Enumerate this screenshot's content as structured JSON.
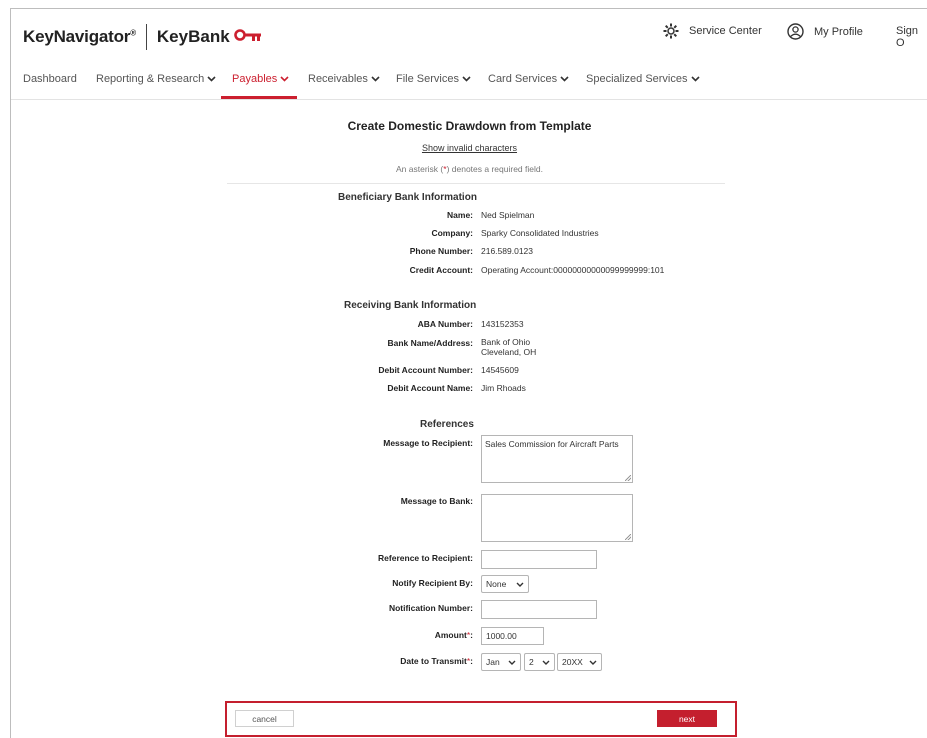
{
  "header": {
    "logo_keynavigator": "KeyNavigator",
    "logo_reg": "®",
    "logo_keybank": "KeyBank",
    "service_center": "Service Center",
    "my_profile": "My Profile",
    "sign_out": "Sign O"
  },
  "nav": {
    "items": [
      {
        "label": "Dashboard"
      },
      {
        "label": "Reporting & Research"
      },
      {
        "label": "Payables"
      },
      {
        "label": "Receivables"
      },
      {
        "label": "File Services"
      },
      {
        "label": "Card Services"
      },
      {
        "label": "Specialized Services"
      }
    ],
    "active": "Payables"
  },
  "page": {
    "title": "Create Domestic Drawdown from Template",
    "invalid_link": "Show invalid characters",
    "required_note_pre": "An asterisk (",
    "required_note_ast": "*",
    "required_note_post": ") denotes a required field."
  },
  "beneficiary": {
    "section_title": "Beneficiary Bank Information",
    "name_label": "Name:",
    "name_value": "Ned Spielman",
    "company_label": "Company:",
    "company_value": "Sparky Consolidated Industries",
    "phone_label": "Phone Number:",
    "phone_value": "216.589.0123",
    "credit_label": "Credit Account:",
    "credit_value": "Operating Account:00000000000099999999:101"
  },
  "receiving": {
    "section_title": "Receiving Bank Information",
    "aba_label": "ABA Number:",
    "aba_value": "143152353",
    "bank_label": "Bank Name/Address:",
    "bank_value_line1": "Bank of Ohio",
    "bank_value_line2": "Cleveland, OH",
    "debit_num_label": "Debit Account Number:",
    "debit_num_value": "14545609",
    "debit_name_label": "Debit Account Name:",
    "debit_name_value": "Jim Rhoads"
  },
  "references": {
    "section_title": "References",
    "msg_recipient_label": "Message to Recipient:",
    "msg_recipient_value": "Sales Commission for Aircraft Parts",
    "msg_bank_label": "Message to Bank:",
    "msg_bank_value": "",
    "ref_recipient_label": "Reference to Recipient:",
    "ref_recipient_value": "",
    "notify_label": "Notify Recipient By:",
    "notify_value": "None",
    "notification_num_label": "Notification Number:",
    "notification_num_value": "",
    "amount_label": "Amount",
    "amount_value": "1000.00",
    "date_label": "Date to Transmit",
    "date_month": "Jan",
    "date_day": "2",
    "date_year": "20XX",
    "required_mark": "*"
  },
  "footer": {
    "cancel_label": "cancel",
    "next_label": "next"
  },
  "colors": {
    "brand_red": "#cc1f2f"
  }
}
